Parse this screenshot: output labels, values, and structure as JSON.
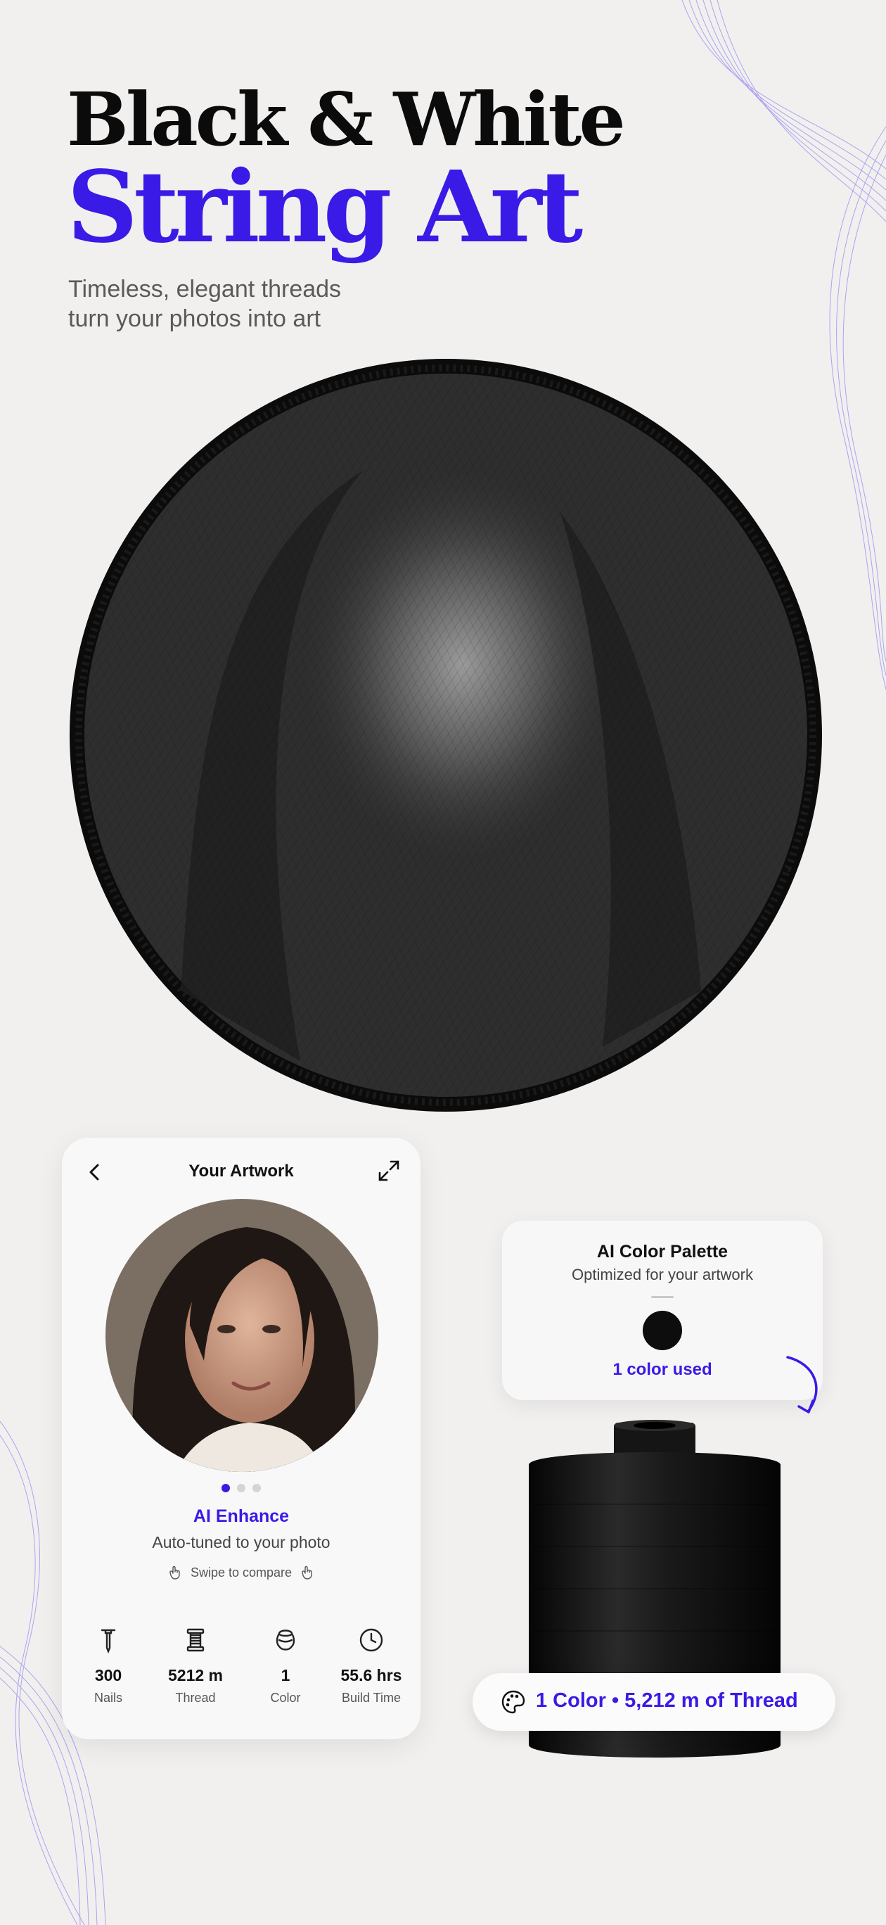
{
  "hero": {
    "title_line1": "Black & White",
    "title_line2": "String Art",
    "subtitle_line1": "Timeless, elegant threads",
    "subtitle_line2": "turn your photos into art"
  },
  "phone": {
    "title": "Your Artwork",
    "carousel_dots": 3,
    "carousel_active_index": 0,
    "enhance_title": "AI Enhance",
    "enhance_subtitle": "Auto-tuned to your photo",
    "swipe_hint": "Swipe to compare",
    "stats": [
      {
        "icon": "nail-icon",
        "value": "300",
        "label": "Nails"
      },
      {
        "icon": "thread-spool-icon",
        "value": "5212 m",
        "label": "Thread"
      },
      {
        "icon": "color-icon",
        "value": "1",
        "label": "Color"
      },
      {
        "icon": "clock-icon",
        "value": "55.6 hrs",
        "label": "Build Time"
      }
    ]
  },
  "palette": {
    "title": "AI Color Palette",
    "subtitle": "Optimized for your artwork",
    "swatch_color": "#0d0d0d",
    "count_label": "1 color used"
  },
  "thread_summary": "1 Color • 5,212 m of Thread",
  "colors": {
    "accent": "#3a1ae6",
    "background": "#f1f0ef",
    "thread": "#0d0d0d"
  }
}
